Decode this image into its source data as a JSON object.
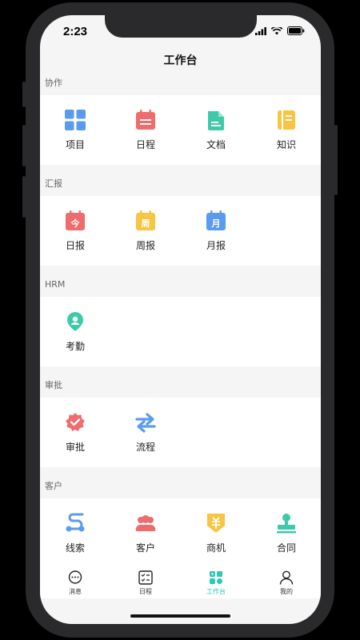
{
  "status_bar": {
    "time": "2:23"
  },
  "nav": {
    "title": "工作台"
  },
  "sections": [
    {
      "title": "协作",
      "items": [
        {
          "label": "项目",
          "icon": "grid-icon",
          "color": "#5b9bef"
        },
        {
          "label": "日程",
          "icon": "calendar-icon",
          "color": "#f06b6b"
        },
        {
          "label": "文档",
          "icon": "document-icon",
          "color": "#3dcaa9"
        },
        {
          "label": "知识",
          "icon": "notebook-icon",
          "color": "#f7c443"
        }
      ]
    },
    {
      "title": "汇报",
      "items": [
        {
          "label": "日报",
          "icon": "daily-report-icon",
          "glyph": "今",
          "color": "#f06b6b"
        },
        {
          "label": "周报",
          "icon": "weekly-report-icon",
          "glyph": "周",
          "color": "#f7c443"
        },
        {
          "label": "月报",
          "icon": "monthly-report-icon",
          "glyph": "月",
          "color": "#5b9bef"
        }
      ]
    },
    {
      "title": "HRM",
      "items": [
        {
          "label": "考勤",
          "icon": "location-pin-icon",
          "color": "#3dcaa9"
        }
      ]
    },
    {
      "title": "审批",
      "items": [
        {
          "label": "审批",
          "icon": "approval-badge-icon",
          "color": "#f06b6b"
        },
        {
          "label": "流程",
          "icon": "flow-arrows-icon",
          "color": "#5b9bef"
        }
      ]
    },
    {
      "title": "客户",
      "items": [
        {
          "label": "线索",
          "icon": "leads-icon",
          "color": "#5b9bef"
        },
        {
          "label": "客户",
          "icon": "customers-icon",
          "color": "#f06b6b"
        },
        {
          "label": "商机",
          "icon": "opportunity-icon",
          "color": "#f7c443"
        },
        {
          "label": "合同",
          "icon": "stamp-icon",
          "color": "#3dcaa9"
        }
      ]
    }
  ],
  "tabs": [
    {
      "label": "消息",
      "icon": "message-icon"
    },
    {
      "label": "日程",
      "icon": "checklist-icon"
    },
    {
      "label": "工作台",
      "icon": "workbench-icon",
      "active": true
    },
    {
      "label": "我的",
      "icon": "profile-icon"
    }
  ],
  "colors": {
    "accent": "#2fc7b6",
    "section_bg": "#f5f5f5"
  }
}
